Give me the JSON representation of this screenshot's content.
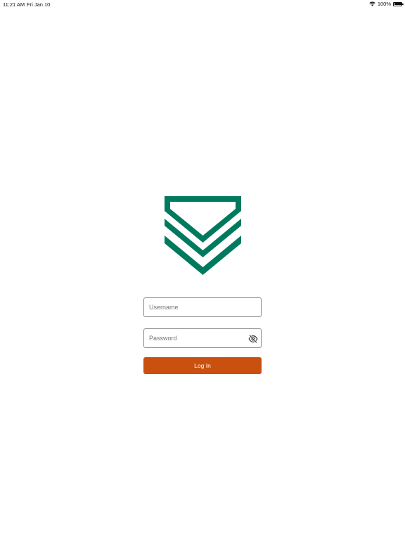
{
  "status_bar": {
    "time": "11:21 AM",
    "date": "Fri Jan 10",
    "battery": "100%",
    "battery_level": 1.0,
    "wifi_icon": "wifi-icon",
    "battery_icon": "battery-icon"
  },
  "logo": {
    "icon": "chevron-rank-logo",
    "color": "#007a5e"
  },
  "login_form": {
    "username_placeholder": "Username",
    "username_value": "",
    "password_placeholder": "Password",
    "password_value": "",
    "password_toggle_icon": "eye-off-icon",
    "login_label": "Log In",
    "button_color": "#c9500f"
  }
}
